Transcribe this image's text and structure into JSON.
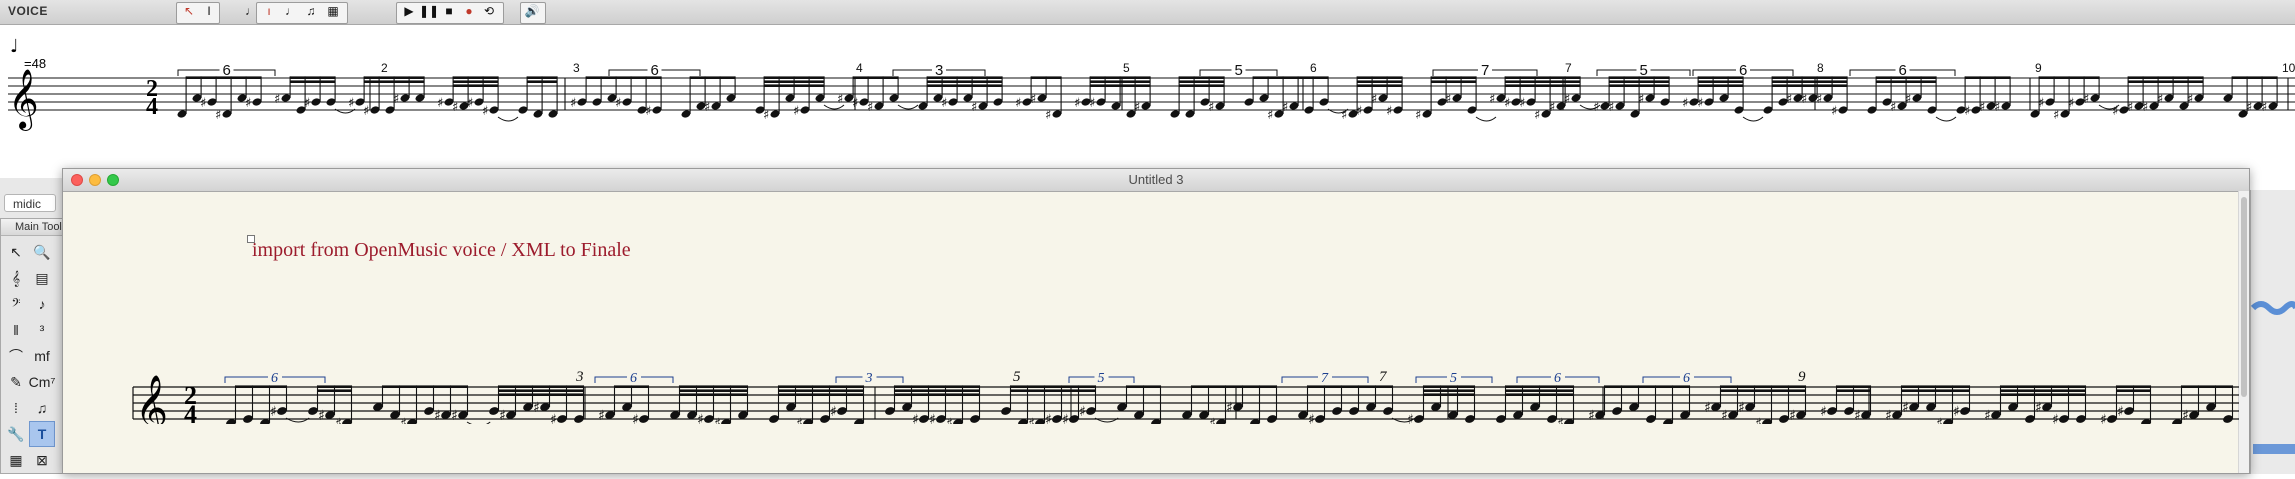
{
  "voice_window": {
    "title": "VOICE",
    "tempo_mark": "=48",
    "time_signature": {
      "top": "2",
      "bottom": "4"
    },
    "measure_numbers": [
      "2",
      "3",
      "4",
      "5",
      "6",
      "7",
      "8",
      "9",
      "10"
    ],
    "tuplet_labels": [
      "6",
      "6",
      "3",
      "5",
      "7",
      "5",
      "6",
      "6"
    ],
    "toolbar_tools": [
      "arrow-tool",
      "text-cursor-tool",
      "red-pen-tool",
      "note-tool",
      "chord-tool",
      "beam-tool",
      "group-tool"
    ],
    "transport": [
      "play",
      "pause",
      "stop",
      "record",
      "loop"
    ],
    "speaker_tool": "speaker-icon"
  },
  "palette": {
    "tab_label": "midic",
    "title": "Main Tool...",
    "tools": [
      {
        "name": "selection-tool",
        "glyph": "↖"
      },
      {
        "name": "zoom-tool",
        "glyph": "🔍"
      },
      {
        "name": "hand-grabber-tool",
        "glyph": "✋"
      },
      {
        "name": "staff-tool",
        "glyph": "𝄞"
      },
      {
        "name": "key-signature-tool",
        "glyph": "▤"
      },
      {
        "name": "time-signature-tool",
        "glyph": "⁄"
      },
      {
        "name": "clef-tool",
        "glyph": "𝄢"
      },
      {
        "name": "simple-entry-tool",
        "glyph": "♪"
      },
      {
        "name": "speedy-entry-tool",
        "glyph": "♪"
      },
      {
        "name": "measure-tool",
        "glyph": "‖"
      },
      {
        "name": "tuplet-tool",
        "glyph": "³"
      },
      {
        "name": "articulation-tool",
        "glyph": "✪"
      },
      {
        "name": "smart-shape-tool",
        "glyph": "⌒"
      },
      {
        "name": "expression-tool",
        "glyph": "mf"
      },
      {
        "name": "repeat-tool",
        "glyph": "𝄆"
      },
      {
        "name": "lyrics-tool",
        "glyph": "✎"
      },
      {
        "name": "chord-tool",
        "glyph": "Cm⁷"
      },
      {
        "name": "fretboard-tool",
        "glyph": "𝄢"
      },
      {
        "name": "mirror-tool",
        "glyph": "⁞"
      },
      {
        "name": "note-mover-tool",
        "glyph": "♫"
      },
      {
        "name": "resize-tool",
        "glyph": "%"
      },
      {
        "name": "special-tools-tool",
        "glyph": "🔧"
      },
      {
        "name": "text-tool",
        "glyph": "T"
      },
      {
        "name": "page-layout-tool",
        "glyph": "▢"
      },
      {
        "name": "graphics-tool",
        "glyph": "▦"
      },
      {
        "name": "staff-styles-tool",
        "glyph": "⊠"
      },
      {
        "name": "mid-tool",
        "glyph": "𝄢"
      }
    ],
    "selected_tool": "text-tool"
  },
  "finale_window": {
    "title": "Untitled 3",
    "text_block": "import from OpenMusic voice / XML to Finale",
    "time_signature": {
      "top": "2",
      "bottom": "4"
    },
    "measure_numbers": [
      "3",
      "5",
      "7",
      "9"
    ],
    "tuplet_labels": [
      "6",
      "6",
      "3",
      "5",
      "7",
      "5",
      "6",
      "6"
    ]
  }
}
